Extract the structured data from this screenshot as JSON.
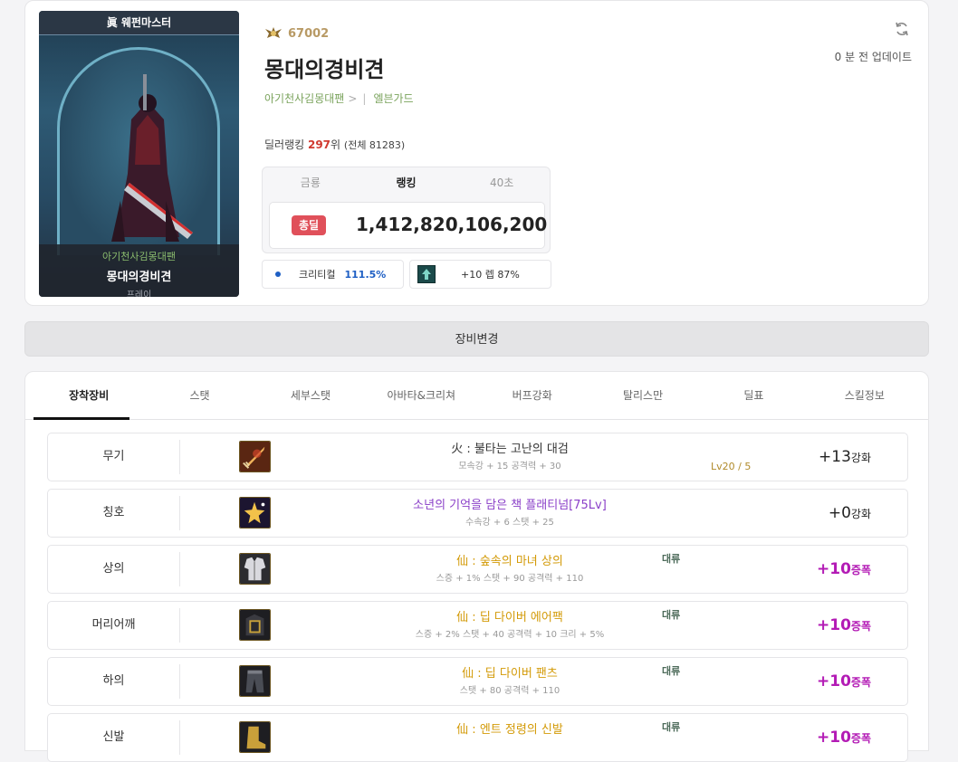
{
  "profile": {
    "class_banner": "眞 웨펀마스터",
    "portrait_guild": "아기천사김몽대팬",
    "portrait_name": "몽대의경비견",
    "portrait_server": "프레이",
    "fame": "67002",
    "name": "몽대의경비견",
    "guild": "아기천사김몽대팬",
    "guild_arrow": ">",
    "guild_sep": "|",
    "job": "엘븐가드",
    "updated": "0 분 전 업데이트",
    "rank_prefix": "딜러랭킹 ",
    "rank_num": "297",
    "rank_suffix": "위 ",
    "rank_total": "(전체 81283)"
  },
  "damage": {
    "tabs": [
      "금룡",
      "랭킹",
      "40초"
    ],
    "active_tab": 1,
    "badge": "총딜",
    "value": "1,412,820,106,200"
  },
  "stats": {
    "crit_label": "크리티컬",
    "crit_value": "111.5%",
    "level_text": "+10 렙 87%"
  },
  "equip_change_label": "장비변경",
  "tabs": [
    "장착장비",
    "스탯",
    "세부스탯",
    "아바타&크리쳐",
    "버프강화",
    "탈리스만",
    "딜표",
    "스킬정보"
  ],
  "equipment": [
    {
      "slot": "무기",
      "name": "火 : 불타는 고난의 대검",
      "sub": "모속강 + 15 공격력 + 30",
      "tag": "",
      "lv": "Lv20 / 5",
      "enh_value": "+13",
      "enh_suffix": "강화",
      "enh_type": "reinforce",
      "color": "#222222",
      "icon": "sword-icon"
    },
    {
      "slot": "칭호",
      "name": "소년의 기억을 담은 책 플래티넘[75Lv]",
      "sub": "수속강 + 6 스탯 + 25",
      "tag": "",
      "lv": "",
      "enh_value": "+0",
      "enh_suffix": "강화",
      "enh_type": "reinforce",
      "color": "#8a3fc8",
      "icon": "title-star-icon"
    },
    {
      "slot": "상의",
      "name": "仙 : 숲속의 마녀 상의",
      "sub": "스증 + 1% 스탯 + 90 공격력 + 110",
      "tag": "대류",
      "lv": "",
      "enh_value": "+10",
      "enh_suffix": "증폭",
      "enh_type": "amplify",
      "color": "#d39a07",
      "icon": "top-armor-icon"
    },
    {
      "slot": "머리어깨",
      "name": "仙 : 딥 다이버 에어팩",
      "sub": "스증 + 2% 스탯 + 40 공격력 + 10 크리 + 5%",
      "tag": "대류",
      "lv": "",
      "enh_value": "+10",
      "enh_suffix": "증폭",
      "enh_type": "amplify",
      "color": "#d39a07",
      "icon": "shoulder-armor-icon"
    },
    {
      "slot": "하의",
      "name": "仙 : 딥 다이버 팬츠",
      "sub": "스탯 + 80 공격력 + 110",
      "tag": "대류",
      "lv": "",
      "enh_value": "+10",
      "enh_suffix": "증폭",
      "enh_type": "amplify",
      "color": "#d39a07",
      "icon": "pants-armor-icon"
    },
    {
      "slot": "신발",
      "name": "仙 : 엔트 정령의 신발",
      "sub": "",
      "tag": "대류",
      "lv": "",
      "enh_value": "+10",
      "enh_suffix": "증폭",
      "enh_type": "amplify",
      "color": "#d39a07",
      "icon": "shoes-armor-icon"
    }
  ]
}
